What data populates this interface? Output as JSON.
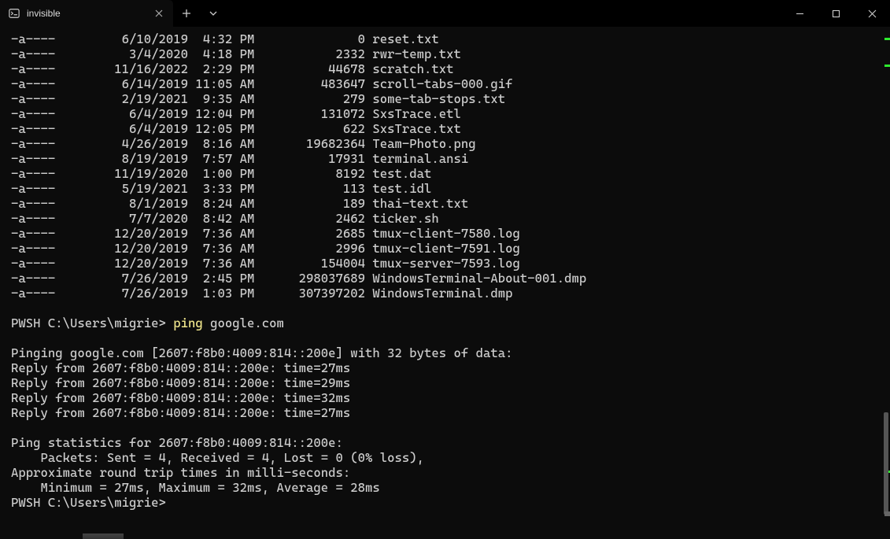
{
  "window": {
    "tab_title": "invisible"
  },
  "files": [
    {
      "mode": "-a----",
      "date": "6/10/2019",
      "time": "4:32 PM",
      "size": "0",
      "name": "reset.txt"
    },
    {
      "mode": "-a----",
      "date": "3/4/2020",
      "time": "4:18 PM",
      "size": "2332",
      "name": "rwr-temp.txt"
    },
    {
      "mode": "-a----",
      "date": "11/16/2022",
      "time": "2:29 PM",
      "size": "44678",
      "name": "scratch.txt"
    },
    {
      "mode": "-a----",
      "date": "6/14/2019",
      "time": "11:05 AM",
      "size": "483647",
      "name": "scroll-tabs-000.gif"
    },
    {
      "mode": "-a----",
      "date": "2/19/2021",
      "time": "9:35 AM",
      "size": "279",
      "name": "some-tab-stops.txt"
    },
    {
      "mode": "-a----",
      "date": "6/4/2019",
      "time": "12:04 PM",
      "size": "131072",
      "name": "SxsTrace.etl"
    },
    {
      "mode": "-a----",
      "date": "6/4/2019",
      "time": "12:05 PM",
      "size": "622",
      "name": "SxsTrace.txt"
    },
    {
      "mode": "-a----",
      "date": "4/26/2019",
      "time": "8:16 AM",
      "size": "19682364",
      "name": "Team-Photo.png"
    },
    {
      "mode": "-a----",
      "date": "8/19/2019",
      "time": "7:57 AM",
      "size": "17931",
      "name": "terminal.ansi"
    },
    {
      "mode": "-a----",
      "date": "11/19/2020",
      "time": "1:00 PM",
      "size": "8192",
      "name": "test.dat"
    },
    {
      "mode": "-a----",
      "date": "5/19/2021",
      "time": "3:33 PM",
      "size": "113",
      "name": "test.idl"
    },
    {
      "mode": "-a----",
      "date": "8/1/2019",
      "time": "8:24 AM",
      "size": "189",
      "name": "thai-text.txt"
    },
    {
      "mode": "-a----",
      "date": "7/7/2020",
      "time": "8:42 AM",
      "size": "2462",
      "name": "ticker.sh"
    },
    {
      "mode": "-a----",
      "date": "12/20/2019",
      "time": "7:36 AM",
      "size": "2685",
      "name": "tmux-client-7580.log"
    },
    {
      "mode": "-a----",
      "date": "12/20/2019",
      "time": "7:36 AM",
      "size": "2996",
      "name": "tmux-client-7591.log"
    },
    {
      "mode": "-a----",
      "date": "12/20/2019",
      "time": "7:36 AM",
      "size": "154004",
      "name": "tmux-server-7593.log"
    },
    {
      "mode": "-a----",
      "date": "7/26/2019",
      "time": "2:45 PM",
      "size": "298037689",
      "name": "WindowsTerminal-About-001.dmp"
    },
    {
      "mode": "-a----",
      "date": "7/26/2019",
      "time": "1:03 PM",
      "size": "307397202",
      "name": "WindowsTerminal.dmp"
    }
  ],
  "prompt1": {
    "prefix": "PWSH C:\\Users\\migrie> ",
    "cmd": "ping",
    "arg": " google.com"
  },
  "ping": {
    "header": "Pinging google.com [2607:f8b0:4009:814::200e] with 32 bytes of data:",
    "replies": [
      "Reply from 2607:f8b0:4009:814::200e: time=27ms",
      "Reply from 2607:f8b0:4009:814::200e: time=29ms",
      "Reply from 2607:f8b0:4009:814::200e: time=32ms",
      "Reply from 2607:f8b0:4009:814::200e: time=27ms"
    ],
    "stats_header": "Ping statistics for 2607:f8b0:4009:814::200e:",
    "packets": "    Packets: Sent = 4, Received = 4, Lost = 0 (0% loss),",
    "rtt_header": "Approximate round trip times in milli-seconds:",
    "rtt": "    Minimum = 27ms, Maximum = 32ms, Average = 28ms"
  },
  "prompt2": "PWSH C:\\Users\\migrie>"
}
